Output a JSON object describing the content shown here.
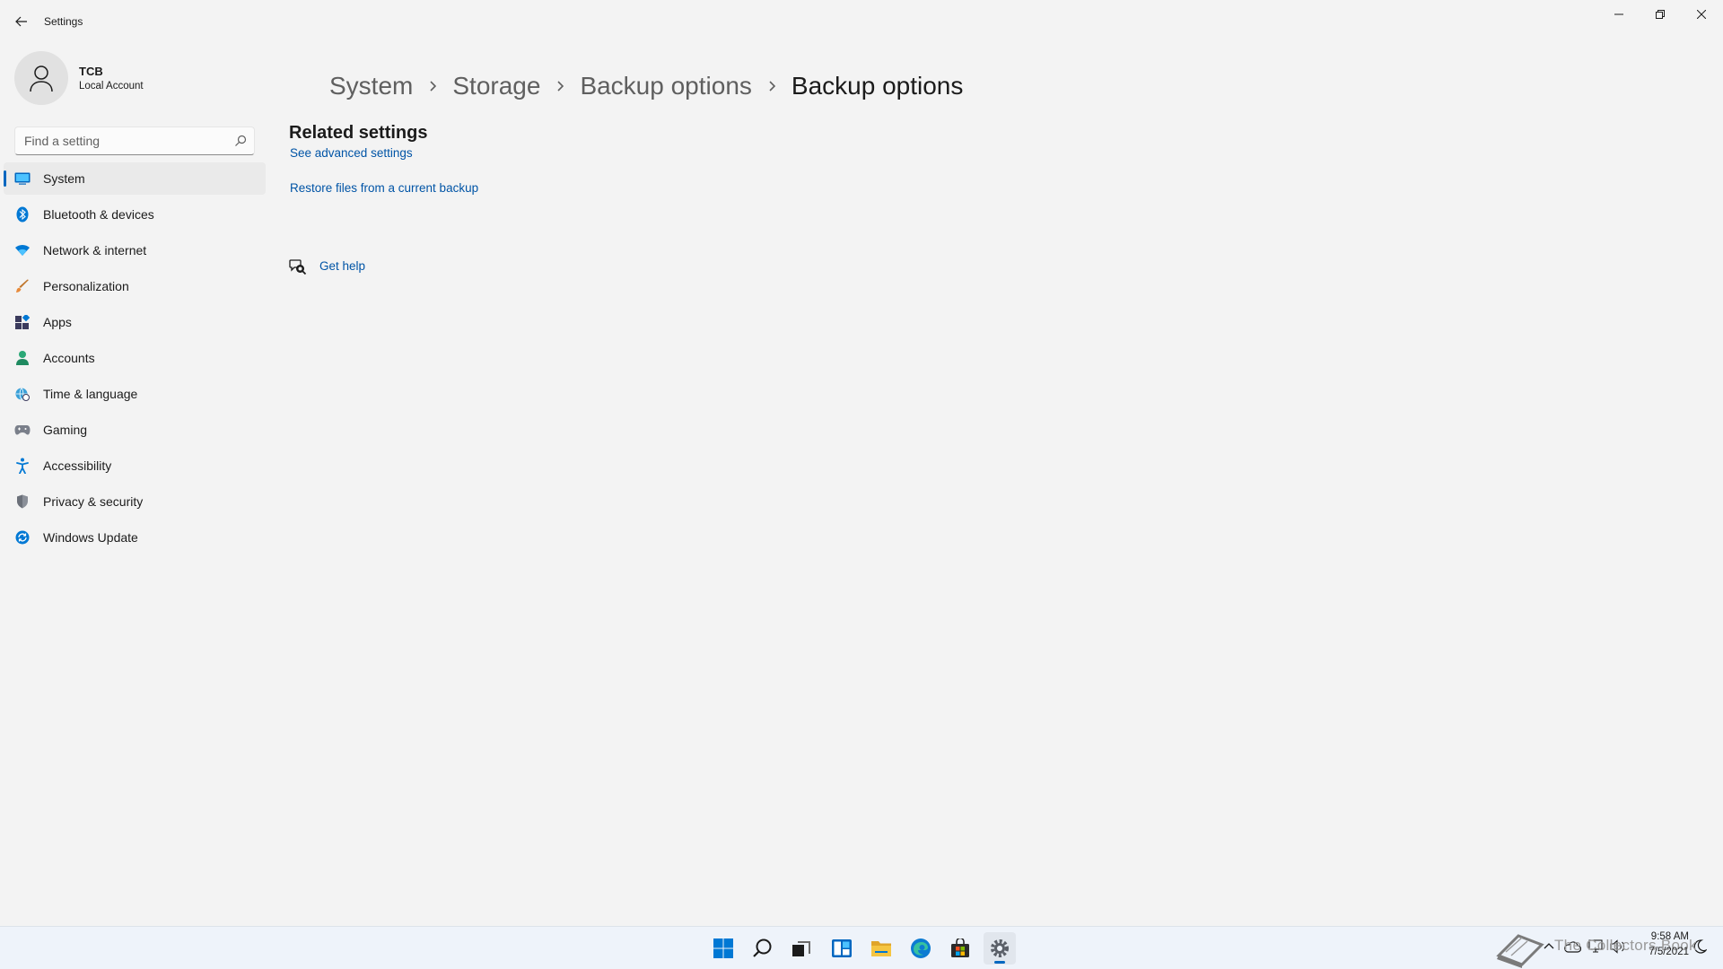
{
  "window": {
    "title": "Settings"
  },
  "profile": {
    "name": "TCB",
    "account_type": "Local Account"
  },
  "search": {
    "placeholder": "Find a setting"
  },
  "nav": {
    "items": [
      {
        "label": "System",
        "icon": "system-icon",
        "active": true
      },
      {
        "label": "Bluetooth & devices",
        "icon": "bluetooth-icon"
      },
      {
        "label": "Network & internet",
        "icon": "wifi-icon"
      },
      {
        "label": "Personalization",
        "icon": "brush-icon"
      },
      {
        "label": "Apps",
        "icon": "apps-icon"
      },
      {
        "label": "Accounts",
        "icon": "person-icon"
      },
      {
        "label": "Time & language",
        "icon": "globe-clock-icon"
      },
      {
        "label": "Gaming",
        "icon": "gamepad-icon"
      },
      {
        "label": "Accessibility",
        "icon": "accessibility-icon"
      },
      {
        "label": "Privacy & security",
        "icon": "shield-icon"
      },
      {
        "label": "Windows Update",
        "icon": "update-icon"
      }
    ]
  },
  "breadcrumb": [
    "System",
    "Storage",
    "Backup options",
    "Backup options"
  ],
  "content": {
    "section_title": "Related settings",
    "links": {
      "advanced": "See advanced settings",
      "restore": "Restore files from a current backup",
      "help": "Get help"
    }
  },
  "taskbar": {
    "icons": [
      "start-icon",
      "search-icon",
      "task-view-icon",
      "widgets-icon",
      "file-explorer-icon",
      "edge-icon",
      "store-icon",
      "settings-icon"
    ],
    "clock_time": "9:58 AM",
    "clock_date": "7/5/2021"
  },
  "watermark": "The Collectors Book",
  "colors": {
    "accent": "#0067c0",
    "link": "#0054a6",
    "background": "#f3f3f3"
  }
}
